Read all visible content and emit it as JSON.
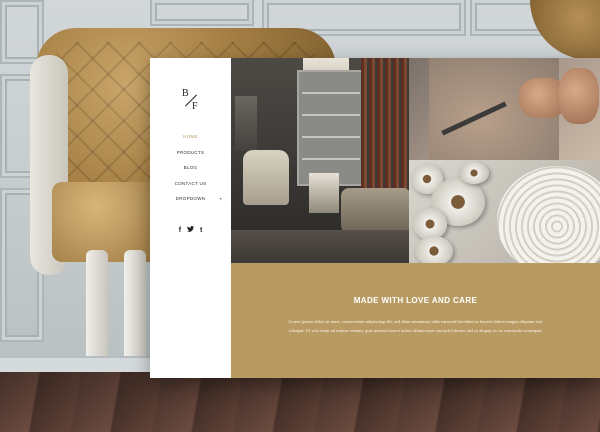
{
  "brand": {
    "logo_b": "B",
    "logo_f": "F"
  },
  "nav": {
    "items": [
      {
        "label": "HOME",
        "active": true
      },
      {
        "label": "PRODUCTS",
        "active": false
      },
      {
        "label": "BLOG",
        "active": false
      },
      {
        "label": "CONTACT US",
        "active": false
      },
      {
        "label": "DROPDOWN",
        "active": false,
        "has_submenu": true
      }
    ]
  },
  "social": {
    "facebook": "f",
    "twitter": "t",
    "tumblr": "t"
  },
  "hero": {
    "title": "MADE WITH LOVE AND CARE",
    "body": "Lorem ipsum dolor sit amet, consectetuer adipiscing elit, sed diam nonummy nibh euismod tincidunt ut laoreet dolore magna aliquam erat volutpat. Ut wisi enim ad minim veniam, quis nostrud exerci tation ullamcorper suscipit lobortis nisl ut aliquip ex ea commodo consequat."
  },
  "colors": {
    "accent": "#b89b63",
    "active_nav": "#b89a62",
    "sidebar_bg": "#ffffff"
  },
  "icons": {
    "submenu": "chevron-down-icon",
    "social": [
      "facebook-icon",
      "twitter-icon",
      "tumblr-icon"
    ]
  }
}
